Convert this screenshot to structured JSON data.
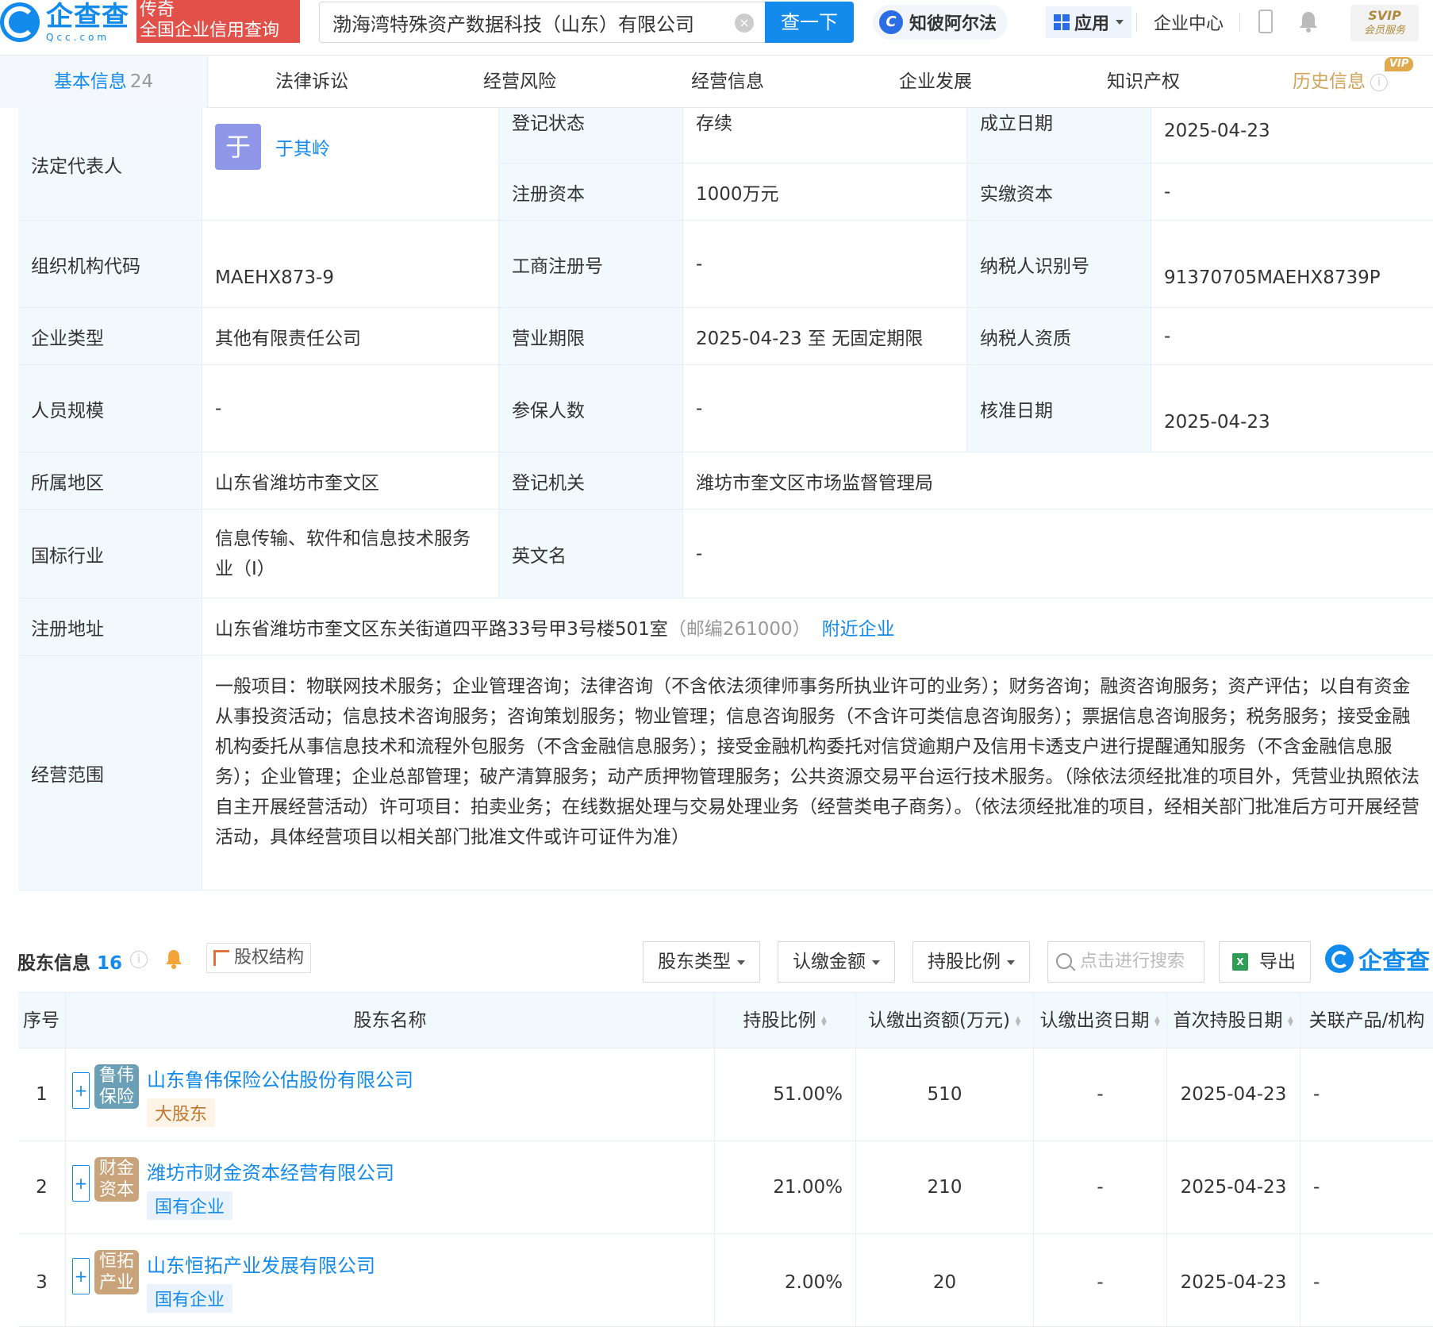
{
  "header": {
    "logo_cn": "企查查",
    "logo_en": "Qcc.com",
    "legend_line1": "传奇",
    "legend_line2": "全国企业信用查询",
    "search_value": "渤海湾特殊资产数据科技（山东）有限公司",
    "search_button": "查一下",
    "zhibi": "知彼阿尔法",
    "apps": "应用",
    "enterprise_center": "企业中心",
    "svip_top": "SVIP",
    "svip_bottom": "会员服务"
  },
  "tabs": [
    {
      "label": "基本信息",
      "count": "24"
    },
    {
      "label": "法律诉讼"
    },
    {
      "label": "经营风险"
    },
    {
      "label": "经营信息"
    },
    {
      "label": "企业发展"
    },
    {
      "label": "知识产权"
    },
    {
      "label": "历史信息",
      "badge": "VIP"
    }
  ],
  "info": {
    "legal_rep_label": "法定代表人",
    "legal_rep_avatar": "于",
    "legal_rep_name": "于其岭",
    "reg_status_label": "登记状态",
    "reg_status": "存续",
    "found_date_label": "成立日期",
    "found_date": "2025-04-23",
    "reg_capital_label": "注册资本",
    "reg_capital": "1000万元",
    "paid_capital_label": "实缴资本",
    "paid_capital": "-",
    "org_code_label": "组织机构代码",
    "org_code": "MAEHX873-9",
    "biz_reg_no_label": "工商注册号",
    "biz_reg_no": "-",
    "taxpayer_id_label": "纳税人识别号",
    "taxpayer_id": "91370705MAEHX8739P",
    "company_type_label": "企业类型",
    "company_type": "其他有限责任公司",
    "biz_term_label": "营业期限",
    "biz_term": "2025-04-23 至 无固定期限",
    "taxpayer_qual_label": "纳税人资质",
    "taxpayer_qual": "-",
    "staff_size_label": "人员规模",
    "staff_size": "-",
    "insured_label": "参保人数",
    "insured": "-",
    "approval_date_label": "核准日期",
    "approval_date": "2025-04-23",
    "region_label": "所属地区",
    "region": "山东省潍坊市奎文区",
    "reg_authority_label": "登记机关",
    "reg_authority": "潍坊市奎文区市场监督管理局",
    "industry_label": "国标行业",
    "industry": "信息传输、软件和信息技术服务业（I）",
    "english_name_label": "英文名",
    "english_name": "-",
    "address_label": "注册地址",
    "address": "山东省潍坊市奎文区东关街道四平路33号甲3号楼501室",
    "postcode": "（邮编261000）",
    "nearby": "附近企业",
    "scope_label": "经营范围",
    "scope": "一般项目：物联网技术服务；企业管理咨询；法律咨询（不含依法须律师事务所执业许可的业务）；财务咨询；融资咨询服务；资产评估；以自有资金从事投资活动；信息技术咨询服务；咨询策划服务；物业管理；信息咨询服务（不含许可类信息咨询服务）；票据信息咨询服务；税务服务；接受金融机构委托从事信息技术和流程外包服务（不含金融信息服务）；接受金融机构委托对信贷逾期户及信用卡透支户进行提醒通知服务（不含金融信息服务）；企业管理；企业总部管理；破产清算服务；动产质押物管理服务；公共资源交易平台运行技术服务。（除依法须经批准的项目外，凭营业执照依法自主开展经营活动）许可项目：拍卖业务；在线数据处理与交易处理业务（经营类电子商务）。（依法须经批准的项目，经相关部门批准后方可开展经营活动，具体经营项目以相关部门批准文件或许可证件为准）"
  },
  "shareholders": {
    "title": "股东信息",
    "count": "16",
    "structure_btn": "股权结构",
    "filter_type": "股东类型",
    "filter_amount": "认缴金额",
    "filter_ratio": "持股比例",
    "search_placeholder": "点击进行搜索",
    "export": "导出",
    "brand": "企查查",
    "columns": [
      "序号",
      "股东名称",
      "持股比例",
      "认缴出资额(万元)",
      "认缴出资日期",
      "首次持股日期",
      "关联产品/机构"
    ],
    "rows": [
      {
        "no": "1",
        "logo": "鲁伟保险",
        "logo_color": "#6a9fb5",
        "name": "山东鲁伟保险公估股份有限公司",
        "tag": "大股东",
        "ratio": "51.00%",
        "amount": "510",
        "sub_date": "-",
        "first_date": "2025-04-23",
        "related": "-"
      },
      {
        "no": "2",
        "logo": "财金资本",
        "logo_color": "#c9a37a",
        "name": "潍坊市财金资本经营有限公司",
        "tag": "国有企业",
        "ratio": "21.00%",
        "amount": "210",
        "sub_date": "-",
        "first_date": "2025-04-23",
        "related": "-"
      },
      {
        "no": "3",
        "logo": "恒拓产业",
        "logo_color": "#c9a37a",
        "name": "山东恒拓产业发展有限公司",
        "tag": "国有企业",
        "ratio": "2.00%",
        "amount": "20",
        "sub_date": "-",
        "first_date": "2025-04-23",
        "related": "-"
      }
    ]
  }
}
